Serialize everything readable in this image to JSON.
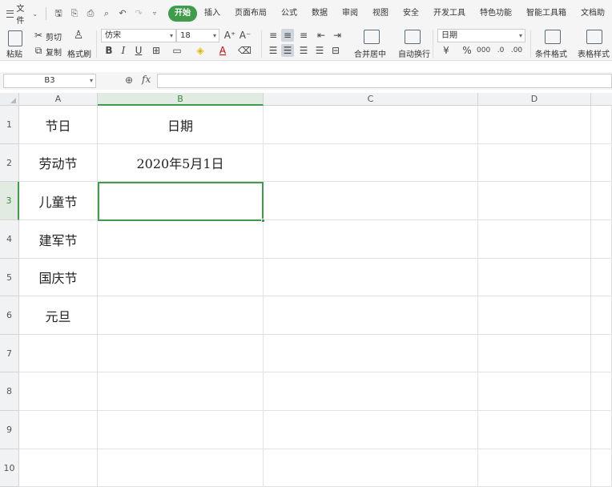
{
  "menubar": {
    "file_label": "文件",
    "tabs": [
      "开始",
      "插入",
      "页面布局",
      "公式",
      "数据",
      "审阅",
      "视图",
      "安全",
      "开发工具",
      "特色功能",
      "智能工具箱",
      "文档助"
    ],
    "active_tab": "开始"
  },
  "ribbon": {
    "paste": "粘贴",
    "cut": "剪切",
    "copy": "复制",
    "format_painter": "格式刷",
    "font_name": "仿宋",
    "font_size": "18",
    "merge_center": "合并居中",
    "wrap_text": "自动换行",
    "number_format": "日期",
    "conditional_format": "条件格式",
    "table_style": "表格样式"
  },
  "formula_bar": {
    "cell_ref": "B3",
    "fx_label": "fx",
    "value": ""
  },
  "grid": {
    "columns": [
      "A",
      "B",
      "C",
      "D"
    ],
    "selected_column": "B",
    "rows": [
      "1",
      "2",
      "3",
      "4",
      "5",
      "6",
      "7",
      "8",
      "9",
      "10"
    ],
    "selected_row": "3",
    "cells": [
      {
        "ref": "A1",
        "text": "节日"
      },
      {
        "ref": "B1",
        "text": "日期"
      },
      {
        "ref": "A2",
        "text": "劳动节"
      },
      {
        "ref": "B2",
        "text": "2020年5月1日"
      },
      {
        "ref": "A3",
        "text": "儿童节"
      },
      {
        "ref": "A4",
        "text": "建军节"
      },
      {
        "ref": "A5",
        "text": "国庆节"
      },
      {
        "ref": "A6",
        "text": "元旦"
      }
    ]
  }
}
